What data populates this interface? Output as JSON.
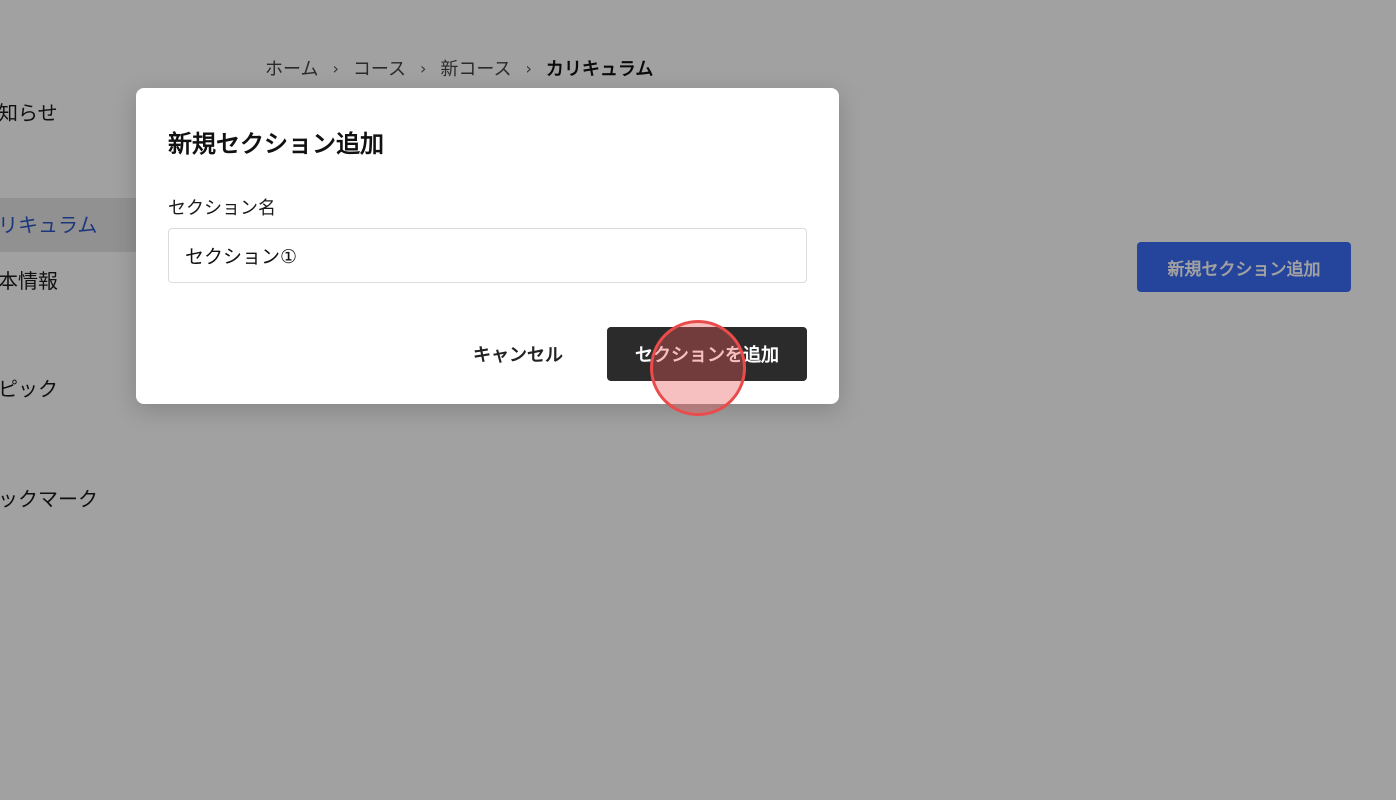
{
  "sidebar": {
    "items": [
      {
        "label": "お知らせ"
      },
      {
        "label": "カリキュラム",
        "active": true
      },
      {
        "label": "基本情報"
      },
      {
        "label": "トピック"
      },
      {
        "label": "ブックマーク"
      }
    ]
  },
  "breadcrumb": {
    "items": [
      "ホーム",
      "コース",
      "新コース"
    ],
    "current": "カリキュラム",
    "separator": "›"
  },
  "main": {
    "add_section_label": "新規セクション追加"
  },
  "modal": {
    "title": "新規セクション追加",
    "field_label": "セクション名",
    "input_value": "セクション①",
    "cancel_label": "キャンセル",
    "confirm_label": "セクションを追加"
  },
  "colors": {
    "accent": "#3b6cf5",
    "active_text": "#2b56c4",
    "primary_button": "#2b2b2b",
    "click_indicator": "#ea4b4b"
  }
}
